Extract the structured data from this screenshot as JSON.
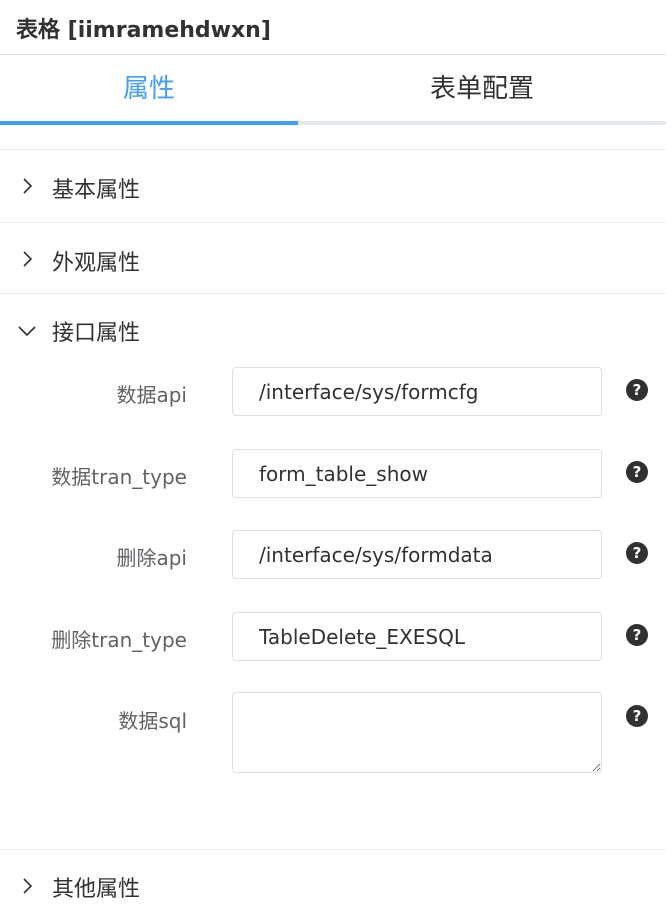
{
  "header": {
    "title": "表格 [iimramehdwxn]"
  },
  "tabs": [
    {
      "label": "属性",
      "active": true
    },
    {
      "label": "表单配置",
      "active": false
    }
  ],
  "sections": {
    "basic": {
      "label": "基本属性",
      "expanded": false
    },
    "appearance": {
      "label": "外观属性",
      "expanded": false
    },
    "interface": {
      "label": "接口属性",
      "expanded": true
    },
    "other": {
      "label": "其他属性",
      "expanded": false
    }
  },
  "fields": [
    {
      "label": "数据api",
      "value": "/interface/sys/formcfg",
      "help_icon": "question-circle-icon"
    },
    {
      "label": "数据tran_type",
      "value": "form_table_show",
      "help_icon": "question-circle-icon"
    },
    {
      "label": "删除api",
      "value": "/interface/sys/formdata",
      "help_icon": "question-circle-icon"
    },
    {
      "label": "删除tran_type",
      "value": "TableDelete_EXESQL",
      "help_icon": "question-circle-icon"
    },
    {
      "label": "数据sql",
      "value": "",
      "help_icon": "question-circle-icon"
    }
  ],
  "help_symbol": "?",
  "colors": {
    "accent": "#409eff",
    "text": "#303133",
    "label": "#606266",
    "border": "#dcdfe6",
    "divider": "#e4e7ed"
  }
}
